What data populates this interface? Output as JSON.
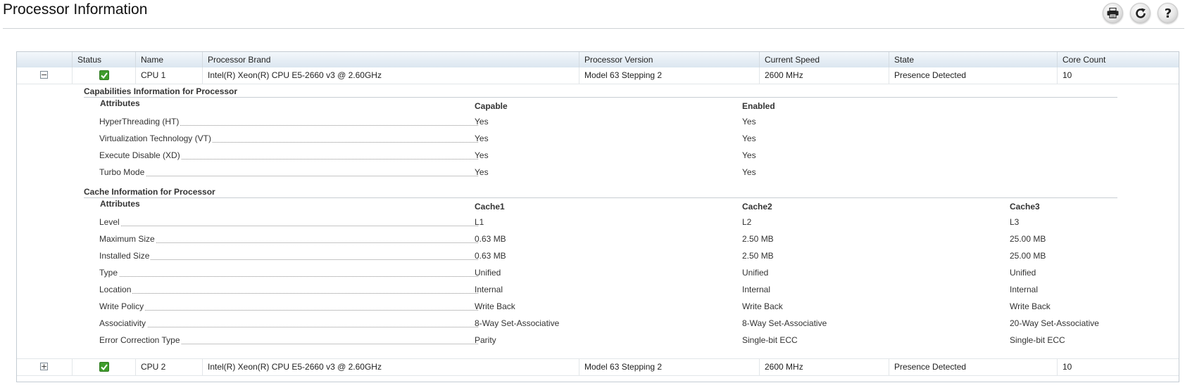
{
  "page": {
    "title": "Processor Information"
  },
  "toolbar": {
    "icons": [
      "print-icon",
      "refresh-icon",
      "help-icon"
    ]
  },
  "table": {
    "columns": [
      "Status",
      "Name",
      "Processor Brand",
      "Processor Version",
      "Current Speed",
      "State",
      "Core Count"
    ],
    "rows": [
      {
        "expanded": true,
        "toggle": "−",
        "status": "ok",
        "name": "CPU 1",
        "brand": "Intel(R) Xeon(R) CPU E5-2660 v3 @ 2.60GHz",
        "version": "Model 63 Stepping 2",
        "speed": "2600 MHz",
        "state": "Presence Detected",
        "cores": "10"
      },
      {
        "expanded": false,
        "toggle": "+",
        "status": "ok",
        "name": "CPU 2",
        "brand": "Intel(R) Xeon(R) CPU E5-2660 v3 @ 2.60GHz",
        "version": "Model 63 Stepping 2",
        "speed": "2600 MHz",
        "state": "Presence Detected",
        "cores": "10"
      }
    ]
  },
  "capabilities": {
    "title": "Capabilities Information for Processor",
    "attr_header": "Attributes",
    "col_headers": [
      "Capable",
      "Enabled"
    ],
    "rows": [
      {
        "label": "HyperThreading (HT)",
        "values": [
          "Yes",
          "Yes"
        ]
      },
      {
        "label": "Virtualization Technology (VT)",
        "values": [
          "Yes",
          "Yes"
        ]
      },
      {
        "label": "Execute Disable (XD)",
        "values": [
          "Yes",
          "Yes"
        ]
      },
      {
        "label": "Turbo Mode",
        "values": [
          "Yes",
          "Yes"
        ]
      }
    ]
  },
  "cache": {
    "title": "Cache Information for Processor",
    "attr_header": "Attributes",
    "col_headers": [
      "Cache1",
      "Cache2",
      "Cache3"
    ],
    "rows": [
      {
        "label": "Level",
        "values": [
          "L1",
          "L2",
          "L3"
        ]
      },
      {
        "label": "Maximum Size",
        "values": [
          "0.63 MB",
          "2.50 MB",
          "25.00 MB"
        ]
      },
      {
        "label": "Installed Size",
        "values": [
          "0.63 MB",
          "2.50 MB",
          "25.00 MB"
        ]
      },
      {
        "label": "Type",
        "values": [
          "Unified",
          "Unified",
          "Unified"
        ]
      },
      {
        "label": "Location",
        "values": [
          "Internal",
          "Internal",
          "Internal"
        ]
      },
      {
        "label": "Write Policy",
        "values": [
          "Write Back",
          "Write Back",
          "Write Back"
        ]
      },
      {
        "label": "Associativity",
        "values": [
          "8-Way Set-Associative",
          "8-Way Set-Associative",
          "20-Way Set-Associative"
        ]
      },
      {
        "label": "Error Correction Type",
        "values": [
          "Parity",
          "Single-bit ECC",
          "Single-bit ECC"
        ]
      }
    ]
  },
  "colors": {
    "status_ok": "#3f9c2c",
    "header_bg": "#dbe6f0",
    "border": "#c4ccd3"
  }
}
